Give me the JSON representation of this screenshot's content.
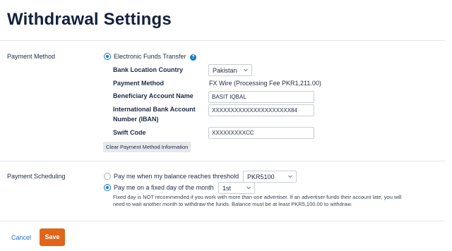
{
  "page": {
    "title": "Withdrawal Settings"
  },
  "payment_method": {
    "section_label": "Payment Method",
    "option_label": "Electronic Funds Transfer",
    "help_icon": "question-circle-icon",
    "bank_country_label": "Bank Location Country",
    "bank_country_value": "Pakistan",
    "method_label": "Payment Method",
    "method_value": "FX Wire (Processing Fee PKR1,211.00)",
    "beneficiary_label": "Beneficiary Account Name",
    "beneficiary_value": "BASIT IQBAL",
    "iban_label_line1": "International Bank Account",
    "iban_label_line2": "Number (IBAN)",
    "iban_value": "XXXXXXXXXXXXXXXXXXXXX84",
    "swift_label": "Swift Code",
    "swift_value": "XXXXXXXXXCC",
    "clear_button": "Clear Payment Method Information"
  },
  "payment_scheduling": {
    "section_label": "Payment Scheduling",
    "threshold_option": "Pay me when my balance reaches threshold",
    "threshold_value": "PKR5100",
    "threshold_selected": false,
    "fixed_day_option": "Pay me on a fixed day of the month",
    "fixed_day_value": "1st",
    "fixed_day_selected": true,
    "note": "Fixed day is NOT recommended if you work with more than one advertiser. If an advertiser funds their account late, you will need to wait another month to withdraw the funds. Balance must be at least PKR5,100.00 to withdraw."
  },
  "footer": {
    "cancel_label": "Cancel",
    "save_label": "Save"
  },
  "colors": {
    "accent": "#1a73c8",
    "save_button": "#e0661a",
    "title": "#14213d"
  }
}
